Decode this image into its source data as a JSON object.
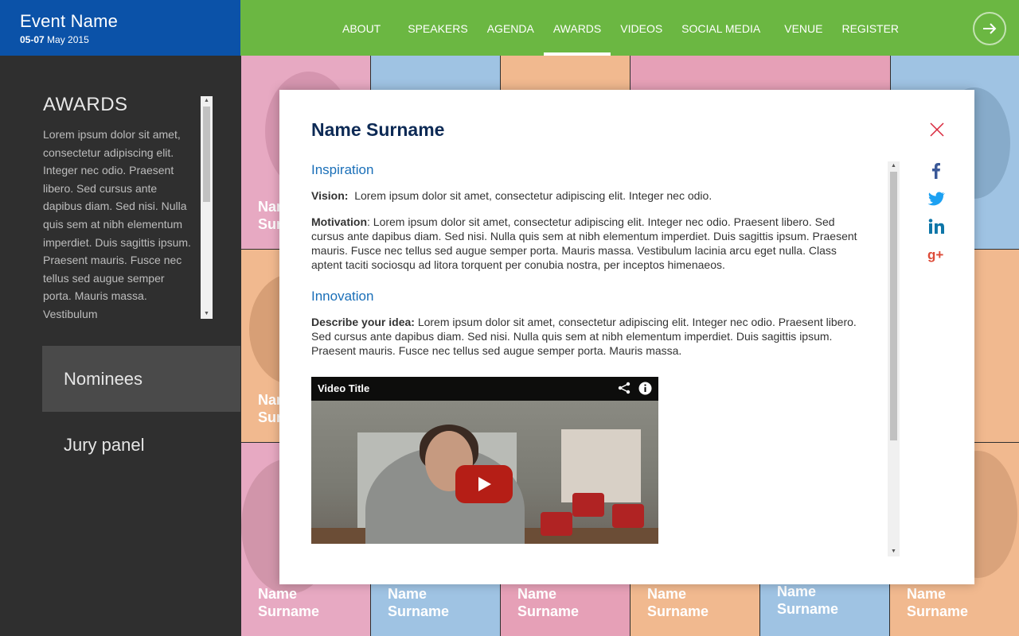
{
  "brand": {
    "event_name": "Event Name",
    "dates_bold": "05-07",
    "dates_rest": " May 2015"
  },
  "nav": {
    "items": [
      "ABOUT",
      "SPEAKERS",
      "AGENDA",
      "AWARDS",
      "VIDEOS",
      "SOCIAL MEDIA",
      "VENUE",
      "REGISTER"
    ],
    "active": "AWARDS",
    "arrow_icon": "arrow-right-icon"
  },
  "sidebar": {
    "title": "AWARDS",
    "description": "Lorem ipsum dolor sit amet, consectetur adipiscing elit. Integer nec odio. Praesent libero. Sed cursus ante dapibus diam. Sed nisi. Nulla quis sem at nibh elementum imperdiet. Duis sagittis ipsum. Praesent mauris. Fusce nec tellus sed augue semper porta. Mauris massa. Vestibulum",
    "items": [
      {
        "label": "Nominees",
        "active": true
      },
      {
        "label": "Jury panel",
        "active": false
      }
    ]
  },
  "mosaic": {
    "tile_first": "Name",
    "tile_last": "Surname",
    "partial_label": "Nam",
    "partial_label2": "Sur",
    "colors": {
      "pink": "#e6a9c1",
      "blue": "#9fc3e3",
      "peach": "#f1b98f"
    }
  },
  "modal": {
    "name": "Name Surname",
    "sections": {
      "inspiration_title": "Inspiration",
      "vision_label": "Vision:",
      "vision_text": "  Lorem ipsum dolor sit amet, consectetur adipiscing elit. Integer nec odio.",
      "motivation_label": "Motivation",
      "motivation_text": ": Lorem ipsum dolor sit amet, consectetur adipiscing elit. Integer nec odio. Praesent libero. Sed cursus ante dapibus diam. Sed nisi. Nulla quis sem at nibh elementum imperdiet. Duis sagittis ipsum. Praesent mauris. Fusce nec tellus sed augue semper porta. Mauris massa. Vestibulum lacinia arcu eget nulla. Class aptent taciti sociosqu ad litora torquent per conubia nostra, per inceptos himenaeos.",
      "innovation_title": "Innovation",
      "idea_label": "Describe your idea:",
      "idea_text": " Lorem ipsum dolor sit amet, consectetur adipiscing elit. Integer nec odio. Praesent libero. Sed cursus ante dapibus diam. Sed nisi. Nulla quis sem at nibh elementum imperdiet. Duis sagittis ipsum. Praesent mauris. Fusce nec tellus sed augue semper porta. Mauris massa."
    },
    "video": {
      "title": "Video Title",
      "icons": [
        "share-icon",
        "info-icon",
        "play-icon"
      ]
    },
    "social": [
      "facebook-icon",
      "twitter-icon",
      "linkedin-icon",
      "google-plus-icon"
    ],
    "colors": {
      "title": "#0d2a55",
      "heading": "#1a6fb8",
      "close": "#d9263b"
    }
  }
}
